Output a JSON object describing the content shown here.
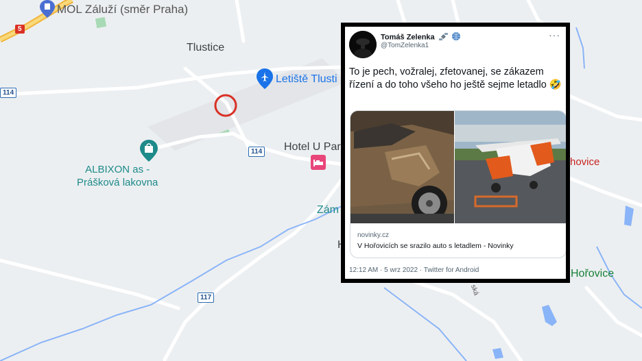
{
  "map": {
    "places": {
      "mol": "MOL Záluží (směr Praha)",
      "tlustice": "Tlustice",
      "airport": "Letiště Tlusti",
      "hotel": "Hotel U Par",
      "albixon_line1": "ALBIXON as -",
      "albixon_line2": "Prášková lakovna",
      "zamek": "Zám",
      "h_fragment": "H",
      "hovice": "hovice",
      "horovice": "H Hořovice",
      "street": "ská"
    },
    "roads": {
      "r5": "5",
      "r114_left": "114",
      "r114_mid": "114",
      "r117": "117"
    },
    "colors": {
      "road": "#ffffff",
      "highway": "#f6cf65",
      "water": "#8ab4f8",
      "park": "#a8dab5",
      "marker": "#d93025"
    },
    "icons": {
      "fuel": "fuel-pin-icon",
      "airport": "airplane-pin-icon",
      "shop": "shopping-bag-pin-icon",
      "hotel": "bed-icon",
      "marker": "red-circle-marker"
    }
  },
  "tweet": {
    "name": "Tomáš Zelenka",
    "handle": "@TomZelenka1",
    "badge_icons": [
      "satellite-icon",
      "globe-icon"
    ],
    "more": "···",
    "text": "To je pech, vožralej, zfetovanej, se zákazem řízení a do toho všeho ho ještě sejme letadlo",
    "emoji": "🤣",
    "card": {
      "domain": "novinky.cz",
      "title": "V Hořovicích se srazilo auto s letadlem - Novinky"
    },
    "meta": "12:12 AM · 5 wrz 2022 · Twitter for Android"
  }
}
